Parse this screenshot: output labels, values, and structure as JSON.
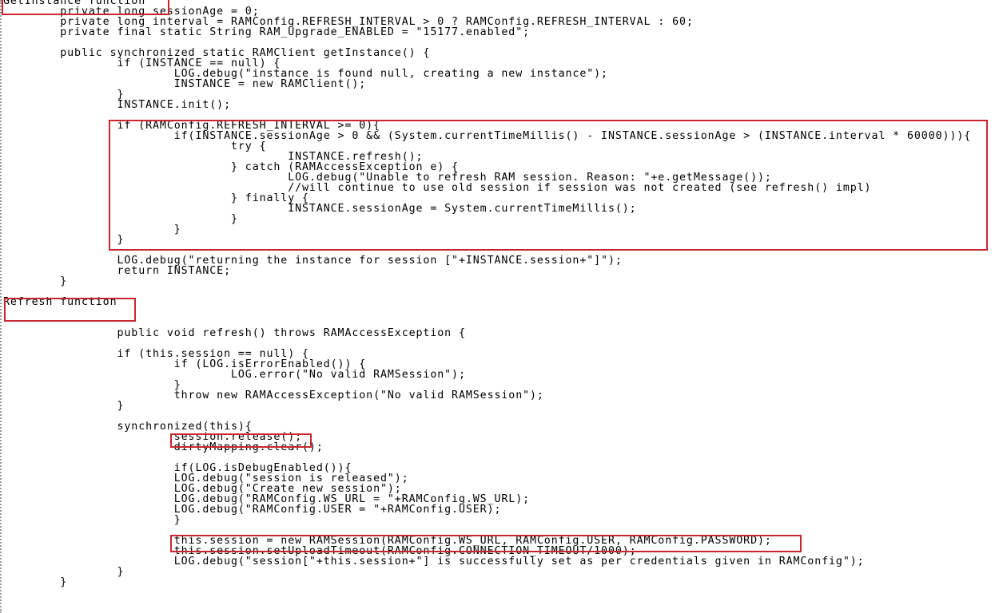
{
  "annotations": {
    "getinstance_label": "GetInstance function",
    "refresh_label": "Refresh function",
    "highlight_color": "#c8262d"
  },
  "code_lines": [
    "GetInstance function",
    "        private long sessionAge = 0;",
    "        private long interval = RAMConfig.REFRESH_INTERVAL > 0 ? RAMConfig.REFRESH_INTERVAL : 60;",
    "        private final static String RAM_Upgrade_ENABLED = \"15177.enabled\";",
    "",
    "        public synchronized static RAMClient getInstance() {",
    "                if (INSTANCE == null) {",
    "                        LOG.debug(\"instance is found null, creating a new instance\");",
    "                        INSTANCE = new RAMClient();",
    "                }",
    "                INSTANCE.init();",
    "",
    "                if (RAMConfig.REFRESH_INTERVAL >= 0){",
    "                        if(INSTANCE.sessionAge > 0 && (System.currentTimeMillis() - INSTANCE.sessionAge > (INSTANCE.interval * 60000))){",
    "                                try {",
    "                                        INSTANCE.refresh();",
    "                                } catch (RAMAccessException e) {",
    "                                        LOG.debug(\"Unable to refresh RAM session. Reason: \"+e.getMessage());",
    "                                        //will continue to use old session if session was not created (see refresh() impl)",
    "                                } finally {",
    "                                        INSTANCE.sessionAge = System.currentTimeMillis();",
    "                                }",
    "                        }",
    "                }",
    "",
    "                LOG.debug(\"returning the instance for session [\"+INSTANCE.session+\"]\");",
    "                return INSTANCE;",
    "        }",
    "",
    "Refresh function",
    "",
    "",
    "                public void refresh() throws RAMAccessException {",
    "",
    "                if (this.session == null) {",
    "                        if (LOG.isErrorEnabled()) {",
    "                                LOG.error(\"No valid RAMSession\");",
    "                        }",
    "                        throw new RAMAccessException(\"No valid RAMSession\");",
    "                }",
    "",
    "                synchronized(this){",
    "                        session.release();",
    "                        dirtyMapping.clear();",
    "",
    "                        if(LOG.isDebugEnabled()){",
    "                        LOG.debug(\"session is released\");",
    "                        LOG.debug(\"Create new session\");",
    "                        LOG.debug(\"RAMConfig.WS_URL = \"+RAMConfig.WS_URL);",
    "                        LOG.debug(\"RAMConfig.USER = \"+RAMConfig.USER);",
    "                        }",
    "",
    "                        this.session = new RAMSession(RAMConfig.WS_URL, RAMConfig.USER, RAMConfig.PASSWORD);",
    "                        this.session.setUploadTimeout(RAMConfig.CONNECTION_TIMEOUT/1000);",
    "                        LOG.debug(\"session[\"+this.session+\"] is successfully set as per credentials given in RAMConfig\");",
    "                }",
    "        }"
  ]
}
